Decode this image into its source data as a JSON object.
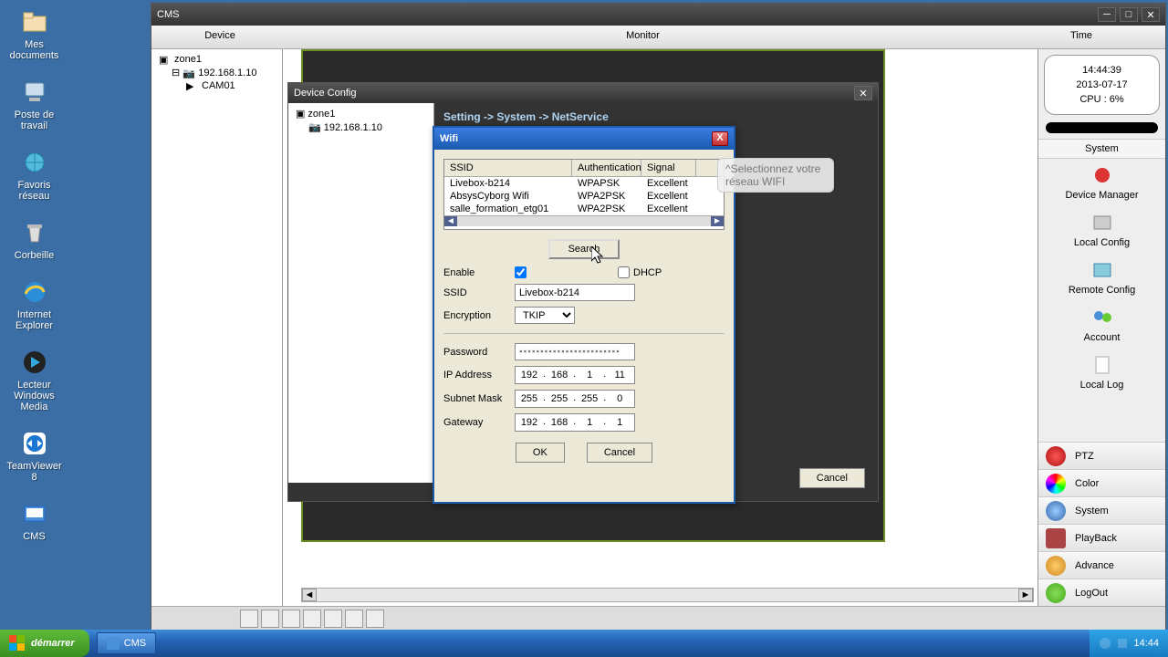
{
  "desktop": {
    "icons": [
      {
        "label": "Mes documents"
      },
      {
        "label": "Poste de travail"
      },
      {
        "label": "Favoris réseau"
      },
      {
        "label": "Corbeille"
      },
      {
        "label": "Internet Explorer"
      },
      {
        "label": "Lecteur Windows Media"
      },
      {
        "label": "TeamViewer 8"
      },
      {
        "label": "CMS"
      }
    ]
  },
  "cms": {
    "title": "CMS",
    "menu": {
      "device": "Device",
      "monitor": "Monitor",
      "time": "Time"
    },
    "status": {
      "time": "14:44:39",
      "date": "2013-07-17",
      "cpu": "CPU : 6%"
    },
    "right_panel": {
      "header": "System",
      "items": [
        "Device Manager",
        "Local Config",
        "Remote Config",
        "Account",
        "Local Log"
      ],
      "bottom": [
        "PTZ",
        "Color",
        "System",
        "PlayBack",
        "Advance",
        "LogOut"
      ]
    },
    "tree": {
      "zone": "zone1",
      "ip": "192.168.1.10",
      "cam": "CAM01"
    }
  },
  "devconf": {
    "title": "Device Config",
    "crumb": "Setting -> System -> NetService",
    "tree": {
      "zone": "zone1",
      "ip": "192.168.1.10"
    },
    "cancel": "Cancel"
  },
  "wifi": {
    "title": "Wifi",
    "tooltip": "^Selectionnez votre réseau WIFI",
    "columns": {
      "ssid": "SSID",
      "auth": "Authentication",
      "signal": "Signal"
    },
    "rows": [
      {
        "ssid": "Livebox-b214",
        "auth": "WPAPSK",
        "signal": "Excellent"
      },
      {
        "ssid": "AbsysCyborg Wifi",
        "auth": "WPA2PSK",
        "signal": "Excellent"
      },
      {
        "ssid": "salle_formation_etg01",
        "auth": "WPA2PSK",
        "signal": "Excellent"
      }
    ],
    "search": "Search",
    "labels": {
      "enable": "Enable",
      "dhcp": "DHCP",
      "ssid": "SSID",
      "encryption": "Encryption",
      "password": "Password",
      "ip": "IP Address",
      "subnet": "Subnet Mask",
      "gateway": "Gateway"
    },
    "values": {
      "ssid": "Livebox-b214",
      "encryption": "TKIP",
      "password": "••••••••••••••••••••",
      "ip": [
        "192",
        "168",
        "1",
        "11"
      ],
      "subnet": [
        "255",
        "255",
        "255",
        "0"
      ],
      "gateway": [
        "192",
        "168",
        "1",
        "1"
      ]
    },
    "enable_checked": true,
    "dhcp_checked": false,
    "ok": "OK",
    "cancel": "Cancel"
  },
  "taskbar": {
    "start": "démarrer",
    "task_cms": "CMS",
    "clock": "14:44"
  }
}
